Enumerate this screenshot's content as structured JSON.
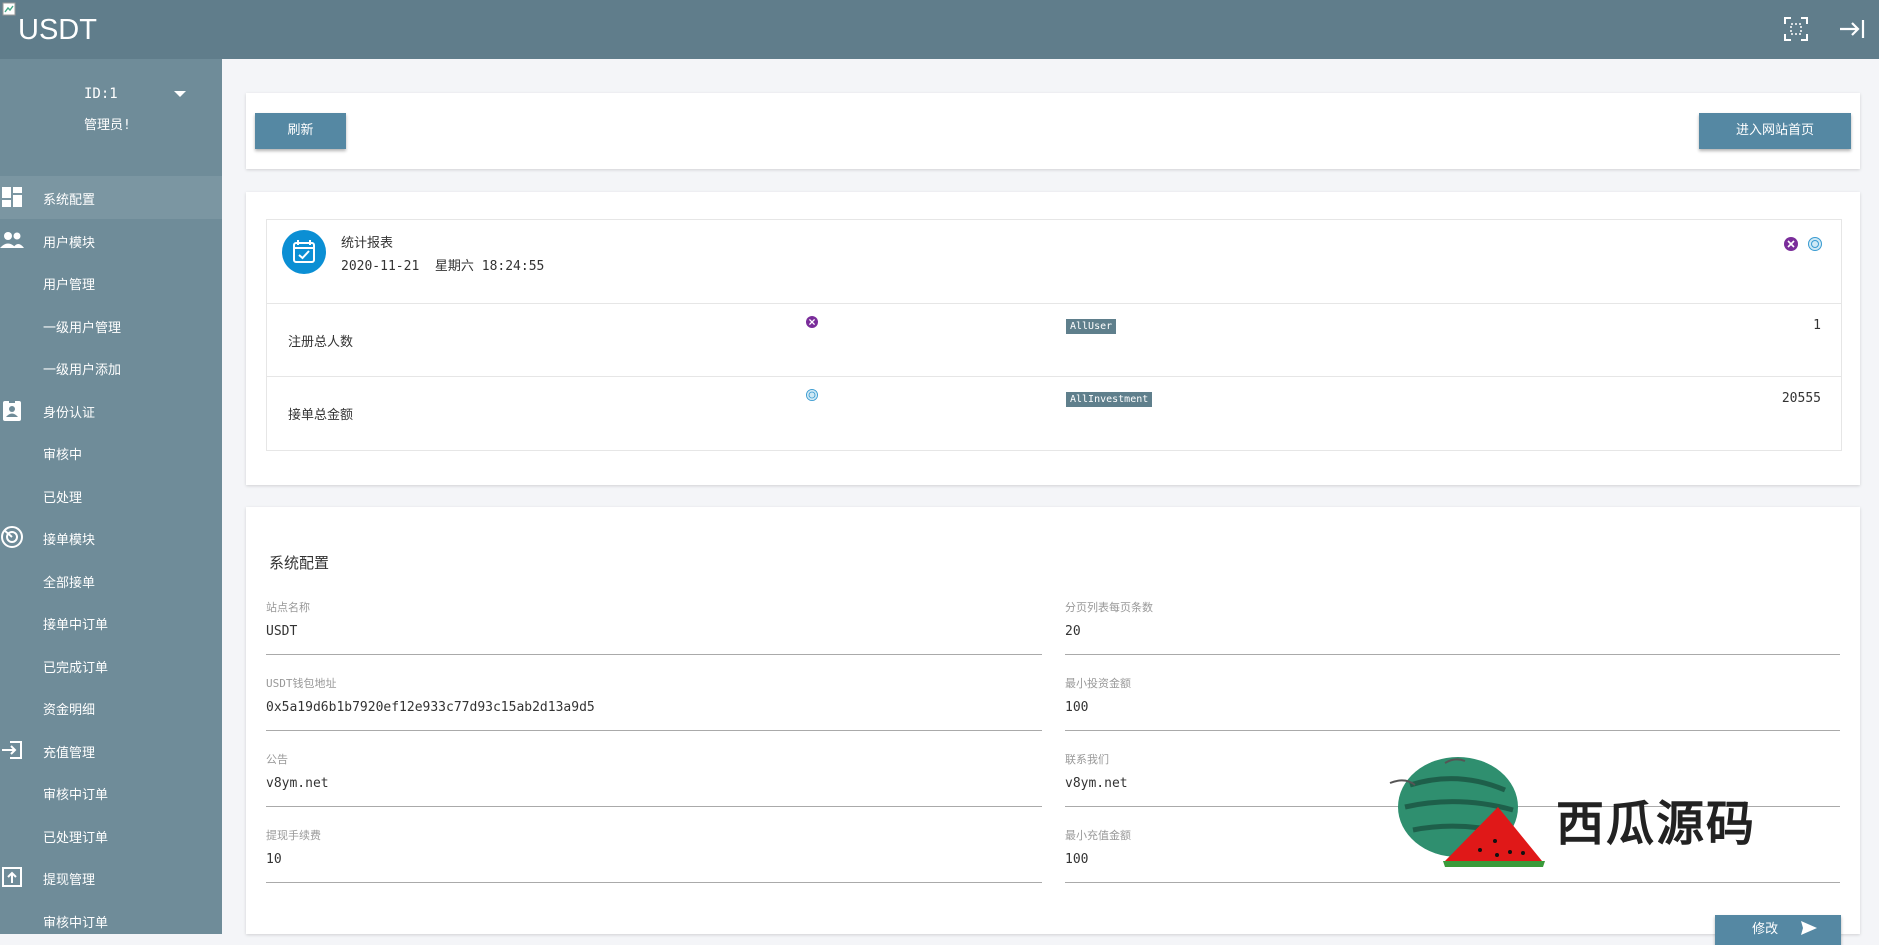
{
  "header": {
    "logo": "USDT",
    "fullscreen_icon": "fullscreen-icon",
    "logout_icon": "logout-icon"
  },
  "user": {
    "id": "ID:1",
    "role": "管理员!"
  },
  "sidebar": {
    "items": [
      {
        "label": "系统配置",
        "icon": "dashboard-icon",
        "type": "section"
      },
      {
        "label": "用户模块",
        "icon": "people-icon",
        "type": "section"
      },
      {
        "label": "用户管理",
        "type": "sub"
      },
      {
        "label": "一级用户管理",
        "type": "sub"
      },
      {
        "label": "一级用户添加",
        "type": "sub"
      },
      {
        "label": "身份认证",
        "icon": "id-badge-icon",
        "type": "section"
      },
      {
        "label": "审核中",
        "type": "sub"
      },
      {
        "label": "已处理",
        "type": "sub"
      },
      {
        "label": "接单模块",
        "icon": "radar-icon",
        "type": "section"
      },
      {
        "label": "全部接单",
        "type": "sub"
      },
      {
        "label": "接单中订单",
        "type": "sub"
      },
      {
        "label": "已完成订单",
        "type": "sub"
      },
      {
        "label": "资金明细",
        "type": "sub"
      },
      {
        "label": "充值管理",
        "icon": "login-icon",
        "type": "section"
      },
      {
        "label": "审核中订单",
        "type": "sub"
      },
      {
        "label": "已处理订单",
        "type": "sub"
      },
      {
        "label": "提现管理",
        "icon": "upload-icon",
        "type": "section"
      },
      {
        "label": "审核中订单",
        "type": "sub"
      }
    ]
  },
  "toolbar": {
    "refresh_label": "刷新",
    "home_label": "进入网站首页"
  },
  "stats": {
    "title": "统计报表",
    "datetime": "2020-11-21  星期六 18:24:55",
    "rows": [
      {
        "label": "注册总人数",
        "tag": "AllUser",
        "value": "1"
      },
      {
        "label": "接单总金额",
        "tag": "AllInvestment",
        "value": "20555"
      }
    ]
  },
  "config": {
    "title": "系统配置",
    "fields": [
      {
        "label": "站点名称",
        "value": "USDT"
      },
      {
        "label": "分页列表每页条数",
        "value": "20"
      },
      {
        "label": "USDT钱包地址",
        "value": "0x5a19d6b1b7920ef12e933c77d93c15ab2d13a9d5"
      },
      {
        "label": "最小投资金额",
        "value": "100"
      },
      {
        "label": "公告",
        "value": "v8ym.net"
      },
      {
        "label": "联系我们",
        "value": "v8ym.net"
      },
      {
        "label": "提现手续费",
        "value": "10"
      },
      {
        "label": "最小充值金额",
        "value": "100"
      }
    ],
    "submit_label": "修改"
  },
  "watermark": {
    "text": "西瓜源码"
  },
  "colors": {
    "topbar": "#607d8b",
    "sidebar": "#6f8c99",
    "button": "#5588a3",
    "accent": "#0b8fd4"
  }
}
